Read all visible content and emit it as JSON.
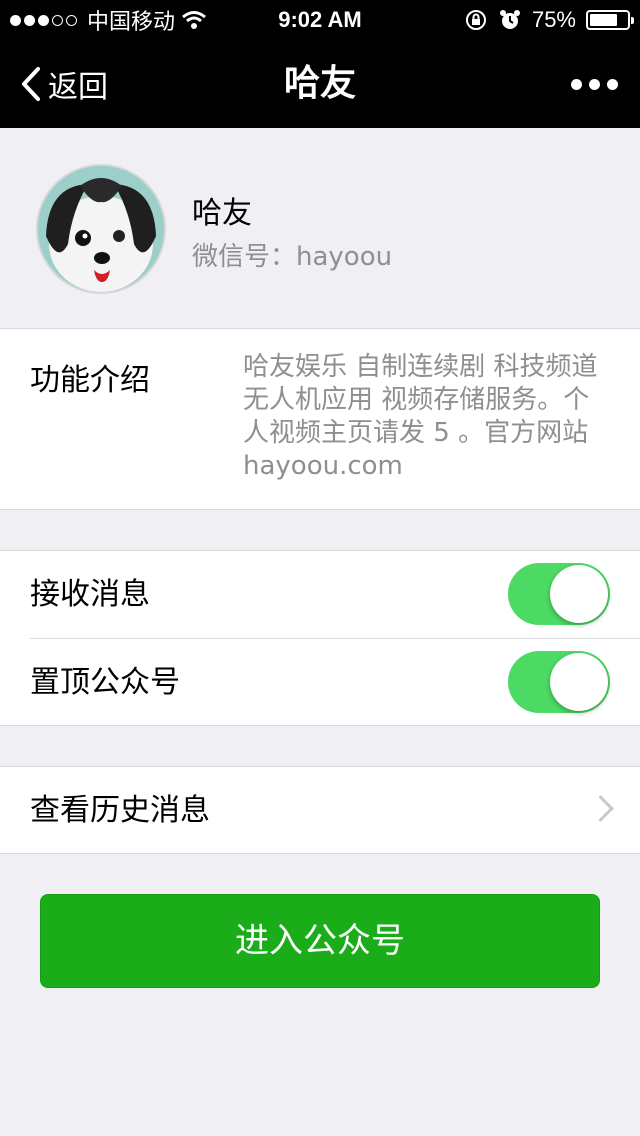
{
  "status_bar": {
    "carrier": "中国移动",
    "time": "9:02 AM",
    "battery_text": "75%",
    "battery_level": 0.75,
    "signal_bars_filled": 3,
    "signal_bars_total": 5
  },
  "nav": {
    "back_label": "返回",
    "title": "哈友"
  },
  "profile": {
    "name": "哈友",
    "wechat_id": "微信号：hayoou"
  },
  "intro": {
    "label": "功能介绍",
    "text": "哈友娱乐 自制连续剧 科技频道 无人机应用 视频存储服务。个人视频主页请发 5 。官方网站 hayoou.com"
  },
  "settings": {
    "receive_messages": {
      "label": "接收消息",
      "on": true
    },
    "pin_account": {
      "label": "置顶公众号",
      "on": true
    }
  },
  "history": {
    "label": "查看历史消息"
  },
  "enter_button": {
    "label": "进入公众号"
  },
  "colors": {
    "toggle_on": "#4cd964",
    "primary_button": "#1aad19",
    "background": "#efeff4"
  }
}
